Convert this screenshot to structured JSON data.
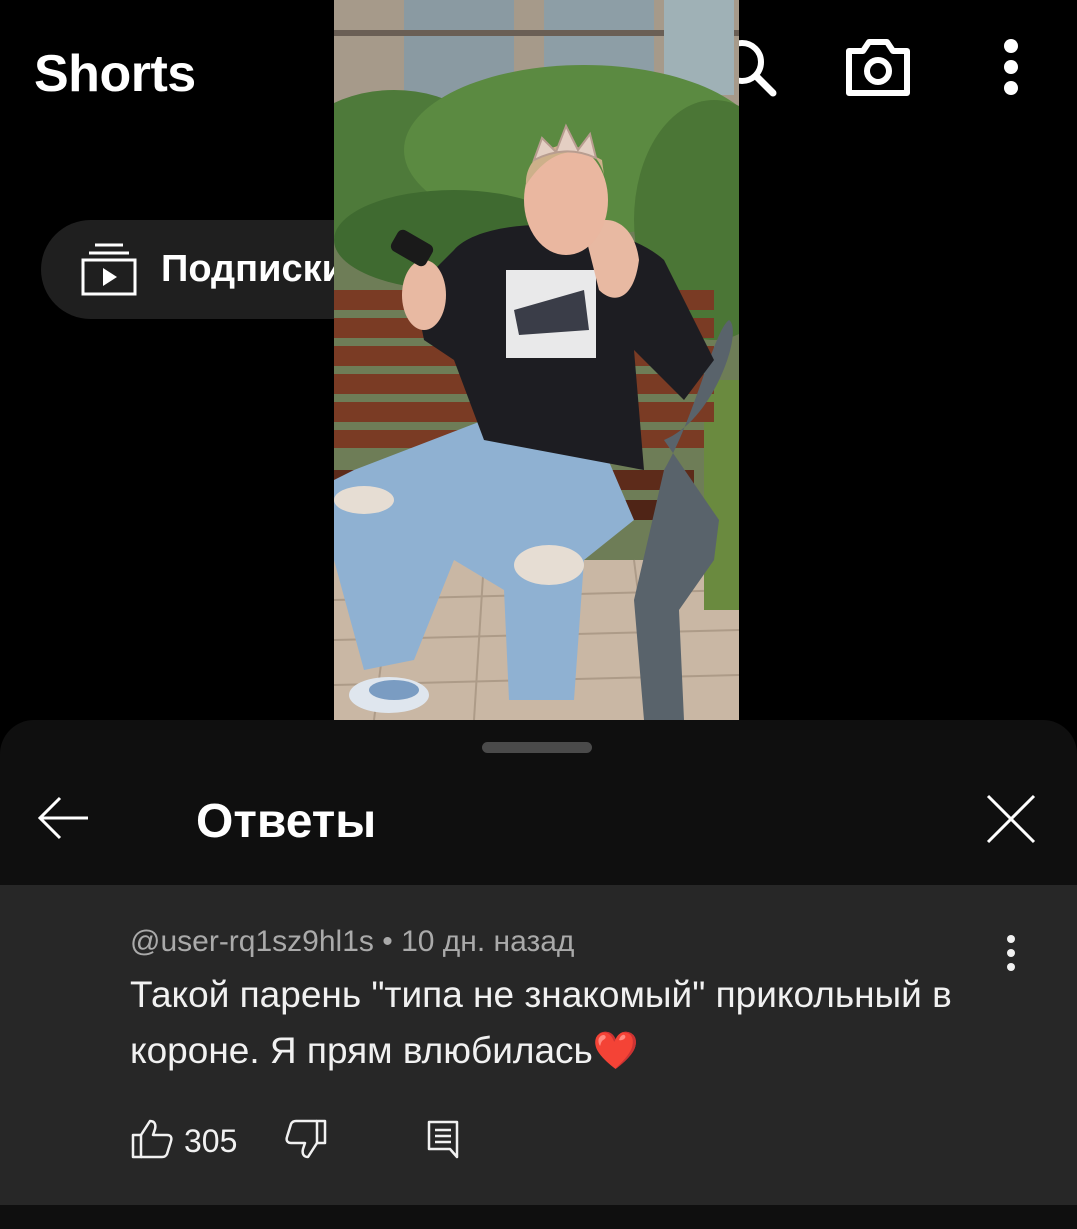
{
  "header": {
    "title": "Shorts",
    "icons": [
      "search-icon",
      "camera-icon",
      "more-vert-icon"
    ]
  },
  "subscriptions_chip": {
    "label": "Подписки",
    "icon": "subscriptions-icon"
  },
  "sheet": {
    "title": "Ответы",
    "back_icon": "arrow-left-icon",
    "close_icon": "close-icon"
  },
  "comment": {
    "author": "@user-rq1sz9hl1s",
    "separator": " • ",
    "time": "10 дн. назад",
    "text": "Такой парень \"типа не знакомый\" прикольный в короне. Я прям влюбилась",
    "emoji": "❤️",
    "likes": "305",
    "icons": [
      "like-icon",
      "dislike-icon",
      "reply-icon",
      "more-vert-icon"
    ]
  },
  "colors": {
    "background": "#000000",
    "sheet": "#0f0f0f",
    "comment_bg": "#272727",
    "chip_bg": "#1f1f1f",
    "meta_text": "#aaaaaa"
  }
}
